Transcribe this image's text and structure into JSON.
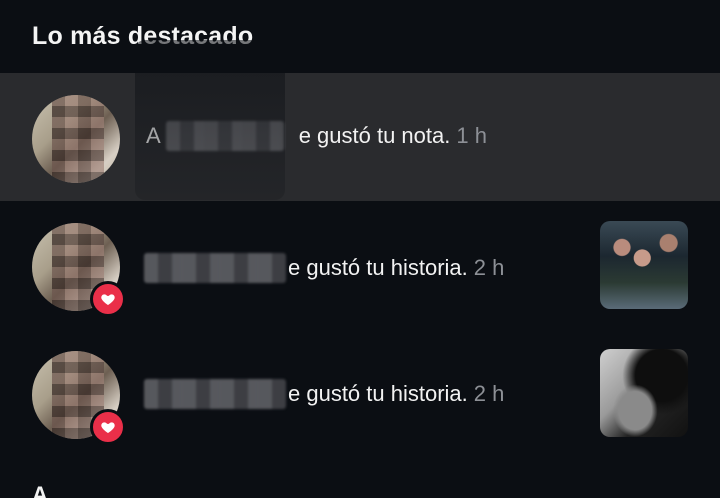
{
  "section": {
    "title": "Lo más destacado"
  },
  "notifications": [
    {
      "text_suffix": "e gustó tu nota.",
      "time": "1 h",
      "prefix_letter": "A",
      "highlighted": true,
      "has_thumbnail": false,
      "has_heart_badge": false
    },
    {
      "text_suffix": "e gustó tu historia.",
      "time": "2 h",
      "highlighted": false,
      "has_thumbnail": true,
      "has_heart_badge": true
    },
    {
      "text_suffix": "e gustó tu historia.",
      "time": "2 h",
      "highlighted": false,
      "has_thumbnail": true,
      "has_heart_badge": true
    }
  ],
  "colors": {
    "background": "#0b0e13",
    "highlight_row": "#2a2b2e",
    "heart_badge": "#ea2f49",
    "time_text": "#8d9096"
  },
  "next_section_peek": "A"
}
